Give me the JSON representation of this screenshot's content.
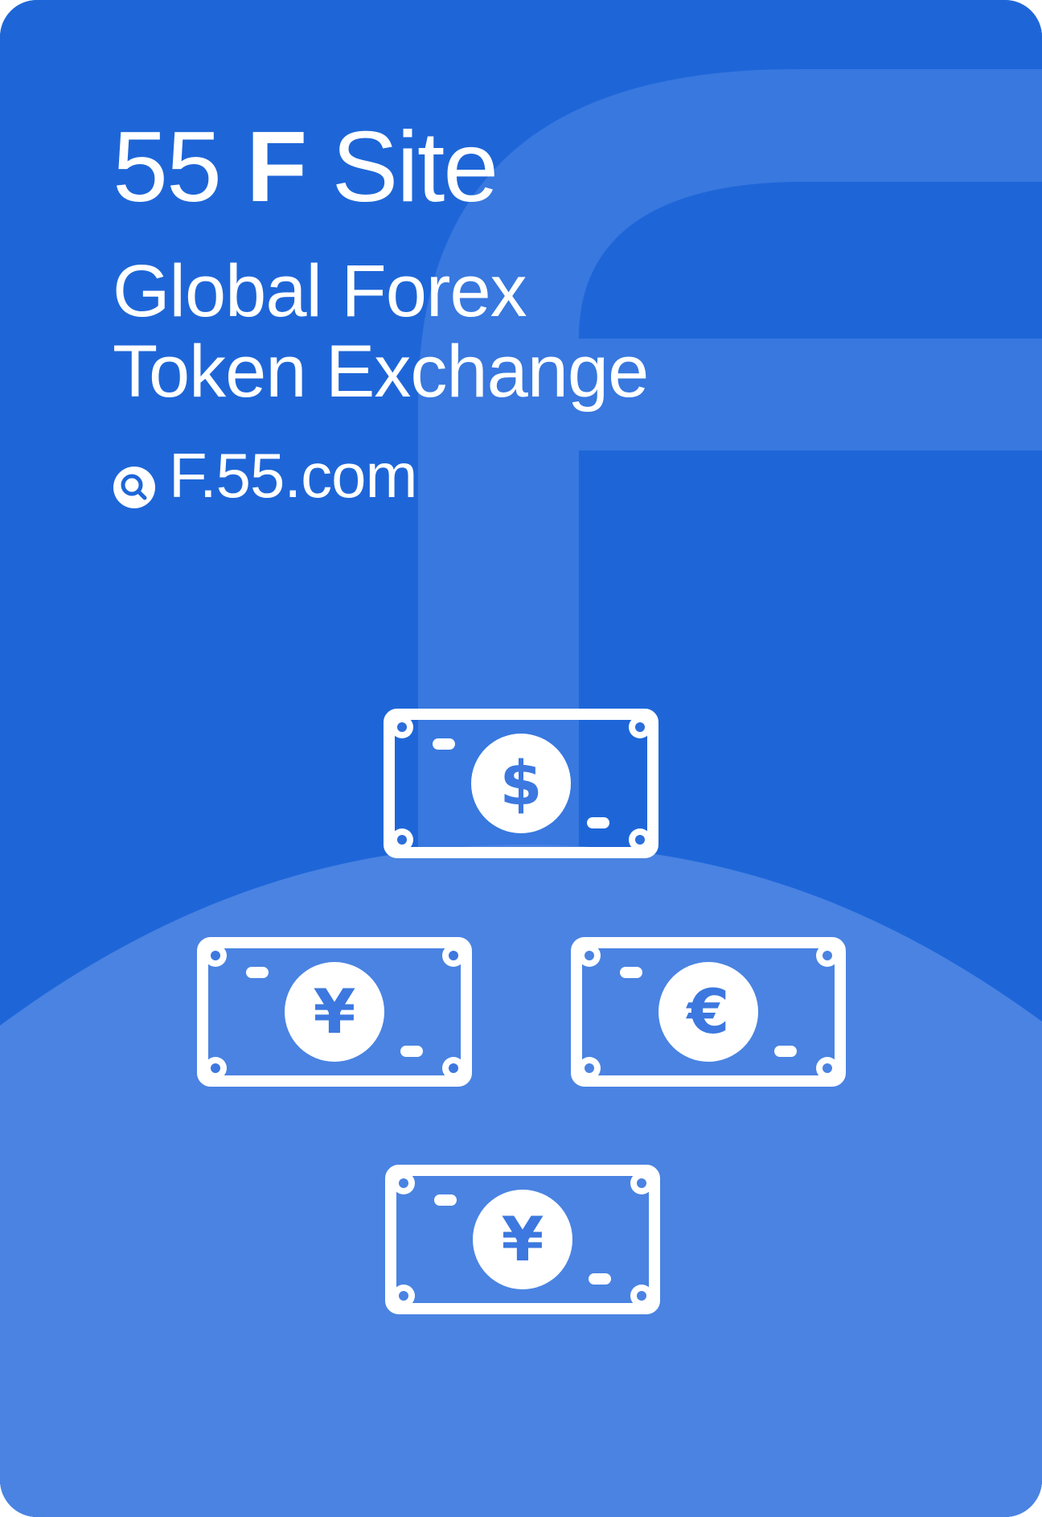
{
  "card": {
    "title_prefix": "55",
    "title_letter": "F",
    "title_suffix": "Site",
    "subtitle_line1": "Global Forex",
    "subtitle_line2": "Token Exchange",
    "site_url": "F.55.com",
    "search_icon": "search-icon"
  },
  "bills": [
    {
      "symbol": "$",
      "currency": "dollar"
    },
    {
      "symbol": "¥",
      "currency": "yen"
    },
    {
      "symbol": "€",
      "currency": "euro"
    },
    {
      "symbol": "¥",
      "currency": "yuan"
    }
  ],
  "colors": {
    "background": "#1e66d8",
    "watermark": "#3b79e0",
    "lower_panel": "#4a83e2",
    "foreground": "#ffffff"
  }
}
